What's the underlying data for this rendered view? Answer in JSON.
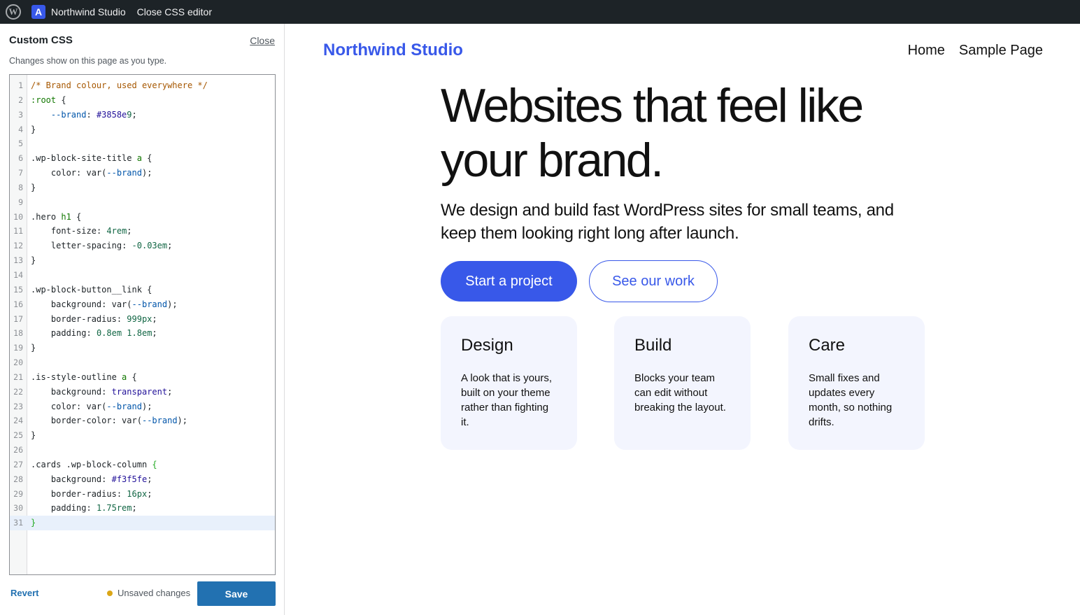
{
  "admin_bar": {
    "site_icon_letter": "A",
    "site_name": "Northwind Studio",
    "close_editor": "Close CSS editor"
  },
  "panel": {
    "title": "Custom CSS",
    "close": "Close",
    "hint": "Changes show on this page as you type.",
    "revert": "Revert",
    "status": "Unsaved changes",
    "save": "Save",
    "code_lines": [
      "/* Brand colour, used everywhere */",
      ":root {",
      "    --brand: #3858e9;",
      "}",
      "",
      ".wp-block-site-title a {",
      "    color: var(--brand);",
      "}",
      "",
      ".hero h1 {",
      "    font-size: 4rem;",
      "    letter-spacing: -0.03em;",
      "}",
      "",
      ".wp-block-button__link {",
      "    background: var(--brand);",
      "    border-radius: 999px;",
      "    padding: 0.8em 1.8em;",
      "}",
      "",
      ".is-style-outline a {",
      "    background: transparent;",
      "    color: var(--brand);",
      "    border-color: var(--brand);",
      "}",
      "",
      ".cards .wp-block-column {",
      "    background: #f3f5fe;",
      "    border-radius: 16px;",
      "    padding: 1.75rem;",
      "}"
    ],
    "active_line": 31
  },
  "preview": {
    "site_title": "Northwind Studio",
    "nav": [
      "Home",
      "Sample Page"
    ],
    "hero_heading_line1": "Websites that feel like",
    "hero_heading_line2": "your brand.",
    "hero_text": "We design and build fast WordPress sites for small teams, and keep them looking right long after launch.",
    "primary_button": "Start a project",
    "outline_button": "See our work",
    "cards": [
      {
        "title": "Design",
        "text": "A look that is yours, built on your theme rather than fighting it."
      },
      {
        "title": "Build",
        "text": "Blocks your team can edit without breaking the layout."
      },
      {
        "title": "Care",
        "text": "Small fixes and updates every month, so nothing drifts."
      }
    ]
  },
  "colors": {
    "brand": "#3858e9",
    "card_bg": "#f3f5fe",
    "admin_bar": "#1d2327",
    "save_button": "#2271b1",
    "unsaved_dot": "#dba617"
  }
}
